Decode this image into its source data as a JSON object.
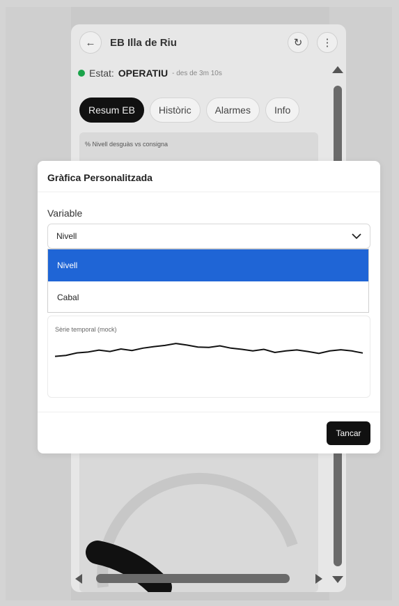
{
  "app": {
    "title": "EB Illa de Riu",
    "back_icon": "arrow-left-icon",
    "refresh_icon": "refresh-icon",
    "menu_icon": "more-vertical-icon"
  },
  "status": {
    "label": "Estat:",
    "value": "OPERATIU",
    "since": "- des de 3m 10s",
    "color": "#1aa34a"
  },
  "tabs": [
    {
      "label": "Resum EB",
      "active": true
    },
    {
      "label": "Històric",
      "active": false
    },
    {
      "label": "Alarmes",
      "active": false
    },
    {
      "label": "Info",
      "active": false
    }
  ],
  "card": {
    "label": "% Nivell desguàs vs consigna"
  },
  "modal": {
    "title": "Gràfica Personalitzada",
    "field_label": "Variable",
    "selected": "Nivell",
    "options": [
      "Nivell",
      "Cabal"
    ],
    "chart_label": "Sèrie temporal (mock)",
    "close_label": "Tancar",
    "accent": "#1f65d6"
  },
  "chart_data": {
    "type": "line",
    "title": "",
    "xlabel": "",
    "ylabel": "",
    "series": [
      {
        "values": [
          0.3,
          0.35,
          0.48,
          0.52,
          0.62,
          0.55,
          0.68,
          0.6,
          0.72,
          0.8,
          0.86,
          0.96,
          0.88,
          0.78,
          0.76,
          0.84,
          0.72,
          0.66,
          0.58,
          0.66,
          0.5,
          0.58,
          0.63,
          0.55,
          0.45,
          0.58,
          0.64,
          0.58,
          0.47
        ]
      }
    ],
    "ylim": [
      0,
      1
    ],
    "grid": false
  }
}
